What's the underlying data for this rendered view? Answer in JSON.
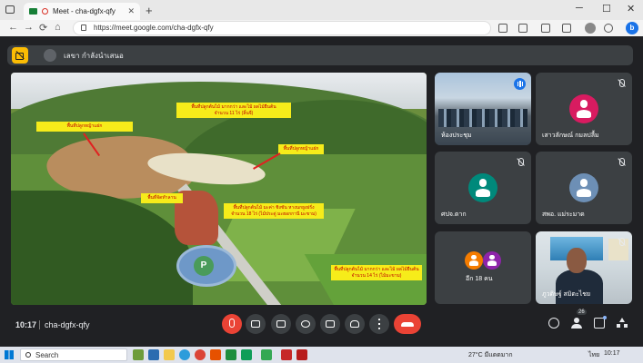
{
  "browser": {
    "tab_title": "Meet - cha-dgfx-qfy",
    "tab_close": "✕",
    "new_tab": "+",
    "window_controls": [
      "─",
      "☐",
      "✕"
    ],
    "url": "https://meet.google.com/cha-dgfx-qfy",
    "back": "←",
    "forward": "→",
    "reload": "⟳",
    "home": "⌂"
  },
  "banner": {
    "text": "เลขา กำลังนำเสนอ"
  },
  "presentation": {
    "labels": [
      "พื้นที่ปลูกหญ้าแฝก",
      "พื้นที่ปลูกต้นไม้ มากกว่า และไม้ ผลไม้ยืนต้น\nจำนวน 11 ไร่ (ลิ้นจี่)",
      "พื้นที่ปลูกหญ้าแฝก",
      "พื้นที่จัดทำลาน",
      "พื้นที่ปลูกต้นไม้ มะค่า ชิงชัน หางนกยูงฝรั่ง\nจำนวน 18 ไร่ (ไม้ประดู่ มะฮอกกานี มะขาม)",
      "พื้นที่ปลูกต้นไม้ มากกว่า และไม้ ผลไม้ยืนต้น\nจำนวน 14 ไร่ (ไม้มะขาม)"
    ],
    "pad_letter": "P"
  },
  "participants": [
    {
      "name": "ห้องประชุม",
      "speaking": true
    },
    {
      "name": "เสาวลักษณ์ กมลปลื้ม",
      "avatar_color": "#d81b60"
    },
    {
      "name": "ศปจ.ตาก",
      "avatar_color": "#00897b"
    },
    {
      "name": "สพอ. แม่ระมาด"
    },
    {
      "name": "อีก 18 คน",
      "avatar_colors": [
        "#f57c00",
        "#8e24aa"
      ]
    },
    {
      "name": "ภูวดิษฐ์ สมิตะไชย"
    }
  ],
  "controls": {
    "time": "10:17",
    "meeting_code": "cha-dgfx-qfy",
    "people_count": "26"
  },
  "taskbar": {
    "search_placeholder": "Search",
    "weather": "27°C มีแดดมาก",
    "lang": "ไทย",
    "clock": "10:17"
  }
}
